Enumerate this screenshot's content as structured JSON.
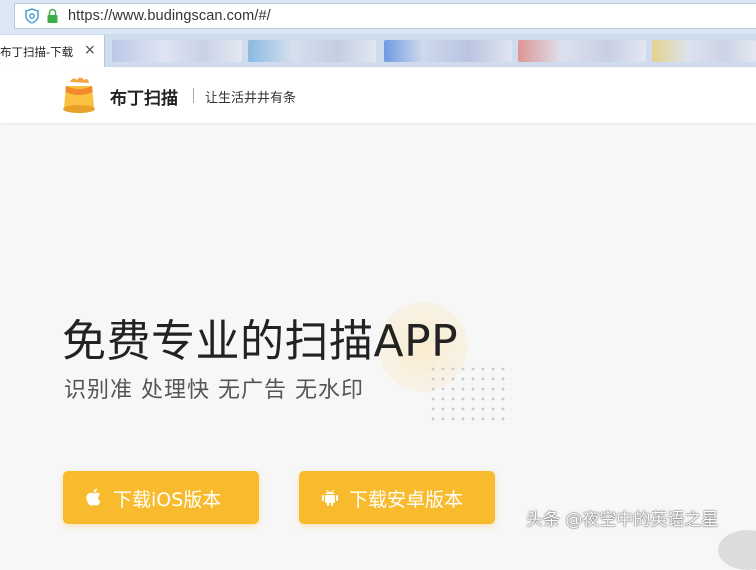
{
  "browser": {
    "url": "https://www.budingscan.com/#/",
    "active_tab_title": "布丁扫描-下载",
    "close_glyph": "×"
  },
  "header": {
    "brand": "布丁扫描",
    "slogan": "让生活井井有条"
  },
  "hero": {
    "title": "免费专业的扫描APP",
    "subtitle": "识别准 处理快 无广告 无水印"
  },
  "downloads": {
    "ios_label": "下载iOS版本",
    "android_label": "下载安卓版本"
  },
  "watermark": "头条 @夜空中的英语之星",
  "colors": {
    "accent": "#f8bb2e",
    "addressbar": "#dbe8f3",
    "tabbar": "#cfdced",
    "page_bg": "#f7f7f7"
  },
  "icons": {
    "address_shield": "shield-icon",
    "address_lock": "lock-icon",
    "ios_button": "apple-icon",
    "android_button": "android-icon"
  }
}
